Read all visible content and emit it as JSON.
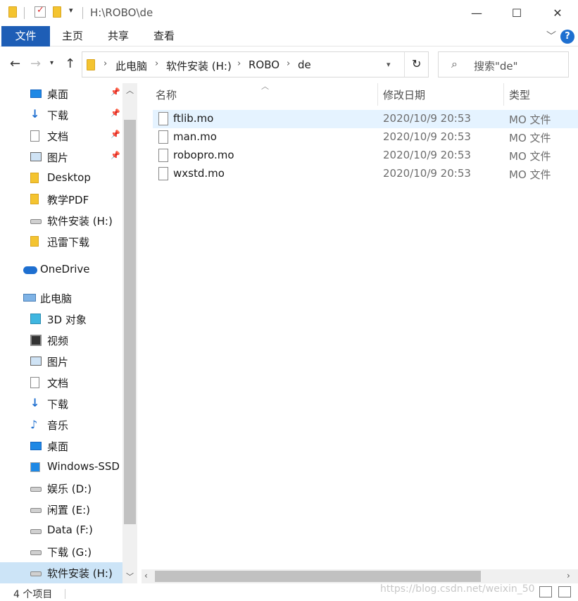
{
  "window": {
    "title": "H:\\ROBO\\de",
    "minimize": "—",
    "maximize": "☐",
    "close": "✕"
  },
  "ribbon": {
    "tabs": [
      "文件",
      "主页",
      "共享",
      "查看"
    ],
    "help": "?"
  },
  "address": {
    "segments": [
      "此电脑",
      "软件安装 (H:)",
      "ROBO",
      "de"
    ],
    "search_placeholder": "搜索\"de\""
  },
  "sidebar": {
    "quick_access": [
      {
        "label": "桌面",
        "icon": "desktop-icon",
        "pinned": true
      },
      {
        "label": "下载",
        "icon": "download-icon",
        "pinned": true
      },
      {
        "label": "文档",
        "icon": "document-icon",
        "pinned": true
      },
      {
        "label": "图片",
        "icon": "picture-icon",
        "pinned": true
      },
      {
        "label": "Desktop",
        "icon": "folder-icon",
        "pinned": false
      },
      {
        "label": "教学PDF",
        "icon": "folder-icon",
        "pinned": false
      },
      {
        "label": "软件安装 (H:)",
        "icon": "drive-icon",
        "pinned": false
      },
      {
        "label": "迅雷下载",
        "icon": "folder-icon",
        "pinned": false
      }
    ],
    "onedrive": {
      "label": "OneDrive",
      "icon": "cloud-icon"
    },
    "this_pc": {
      "label": "此电脑",
      "icon": "computer-icon"
    },
    "pc_items": [
      {
        "label": "3D 对象",
        "icon": "cube-icon"
      },
      {
        "label": "视频",
        "icon": "video-icon"
      },
      {
        "label": "图片",
        "icon": "picture-icon"
      },
      {
        "label": "文档",
        "icon": "document-icon"
      },
      {
        "label": "下载",
        "icon": "download-icon"
      },
      {
        "label": "音乐",
        "icon": "music-icon"
      },
      {
        "label": "桌面",
        "icon": "desktop-icon"
      },
      {
        "label": "Windows-SSD",
        "icon": "windows-drive-icon"
      },
      {
        "label": "娱乐 (D:)",
        "icon": "drive-icon"
      },
      {
        "label": "闲置 (E:)",
        "icon": "drive-icon"
      },
      {
        "label": "Data (F:)",
        "icon": "drive-icon"
      },
      {
        "label": "下载 (G:)",
        "icon": "drive-icon"
      },
      {
        "label": "软件安装 (H:)",
        "icon": "drive-icon"
      }
    ]
  },
  "content": {
    "columns": {
      "name": "名称",
      "date": "修改日期",
      "type": "类型"
    },
    "files": [
      {
        "name": "ftlib.mo",
        "date": "2020/10/9 20:53",
        "type": "MO 文件"
      },
      {
        "name": "man.mo",
        "date": "2020/10/9 20:53",
        "type": "MO 文件"
      },
      {
        "name": "robopro.mo",
        "date": "2020/10/9 20:53",
        "type": "MO 文件"
      },
      {
        "name": "wxstd.mo",
        "date": "2020/10/9 20:53",
        "type": "MO 文件"
      }
    ]
  },
  "status": {
    "item_count": "4 个项目",
    "watermark": "https://blog.csdn.net/weixin_50"
  }
}
